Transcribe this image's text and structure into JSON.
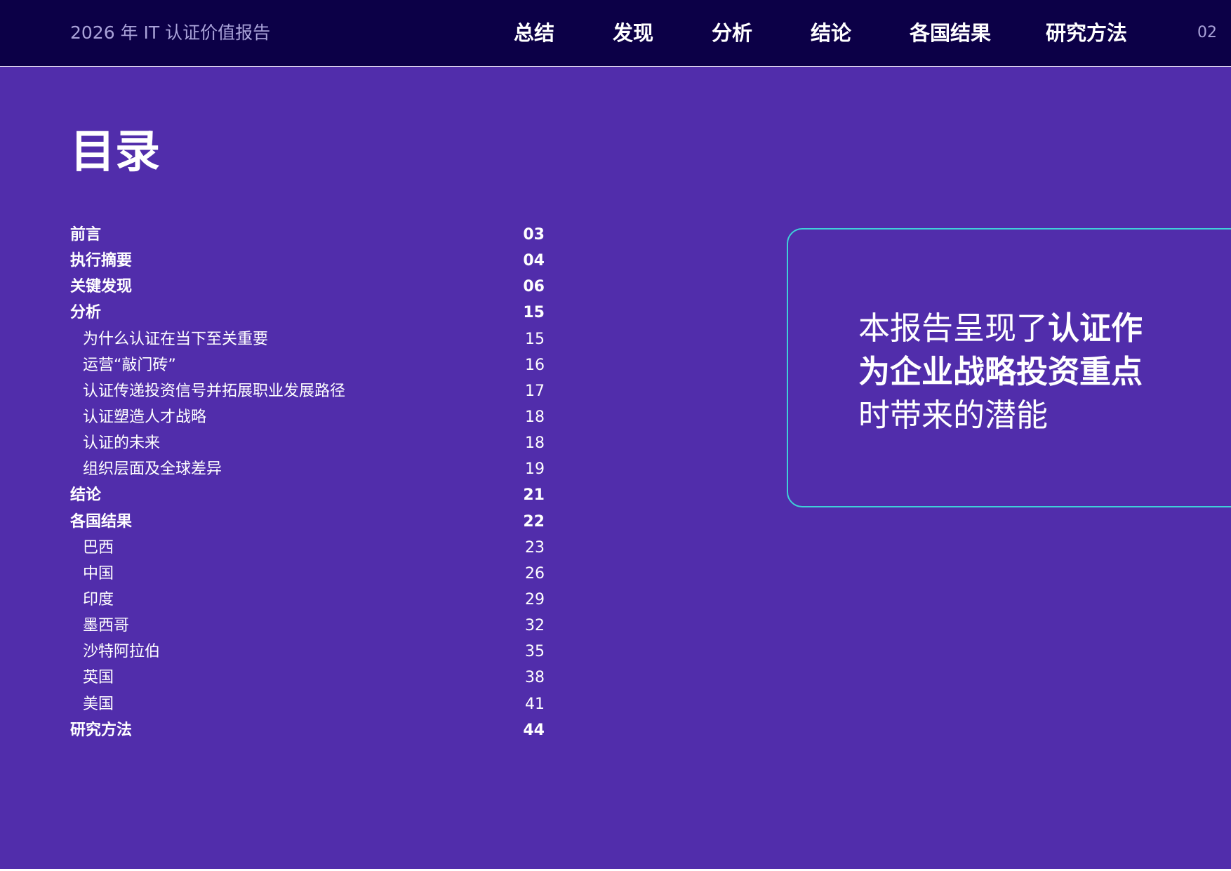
{
  "header": {
    "report_title": "2026 年 IT 认证价值报告",
    "nav": [
      "总结",
      "发现",
      "分析",
      "结论",
      "各国结果",
      "研究方法"
    ],
    "page_number": "02"
  },
  "toc": {
    "heading": "目录",
    "entries": [
      {
        "label": "前言",
        "page": "03",
        "level": 1
      },
      {
        "label": "执行摘要",
        "page": "04",
        "level": 1
      },
      {
        "label": "关键发现",
        "page": "06",
        "level": 1
      },
      {
        "label": "分析",
        "page": "15",
        "level": 1
      },
      {
        "label": "为什么认证在当下至关重要",
        "page": "15",
        "level": 2
      },
      {
        "label": "运营“敲门砖”",
        "page": "16",
        "level": 2
      },
      {
        "label": "认证传递投资信号并拓展职业发展路径",
        "page": "17",
        "level": 2
      },
      {
        "label": "认证塑造人才战略",
        "page": "18",
        "level": 2
      },
      {
        "label": "认证的未来",
        "page": "18",
        "level": 2
      },
      {
        "label": "组织层面及全球差异",
        "page": "19",
        "level": 2
      },
      {
        "label": "结论",
        "page": "21",
        "level": 1
      },
      {
        "label": "各国结果",
        "page": "22",
        "level": 1
      },
      {
        "label": "巴西",
        "page": "23",
        "level": 2
      },
      {
        "label": "中国",
        "page": "26",
        "level": 2
      },
      {
        "label": "印度",
        "page": "29",
        "level": 2
      },
      {
        "label": "墨西哥",
        "page": "32",
        "level": 2
      },
      {
        "label": "沙特阿拉伯",
        "page": "35",
        "level": 2
      },
      {
        "label": "英国",
        "page": "38",
        "level": 2
      },
      {
        "label": "美国",
        "page": "41",
        "level": 2
      },
      {
        "label": "研究方法",
        "page": "44",
        "level": 1
      }
    ]
  },
  "callout": {
    "text_before": "本报告呈现了",
    "text_bold": "认证作为企业战略投资重点",
    "text_after": "时带来的潜能"
  },
  "colors": {
    "header_bg": "#0c0047",
    "page_bg": "#512dab",
    "callout_border": "#3fd0d8",
    "muted_text": "#a9a2d8"
  }
}
